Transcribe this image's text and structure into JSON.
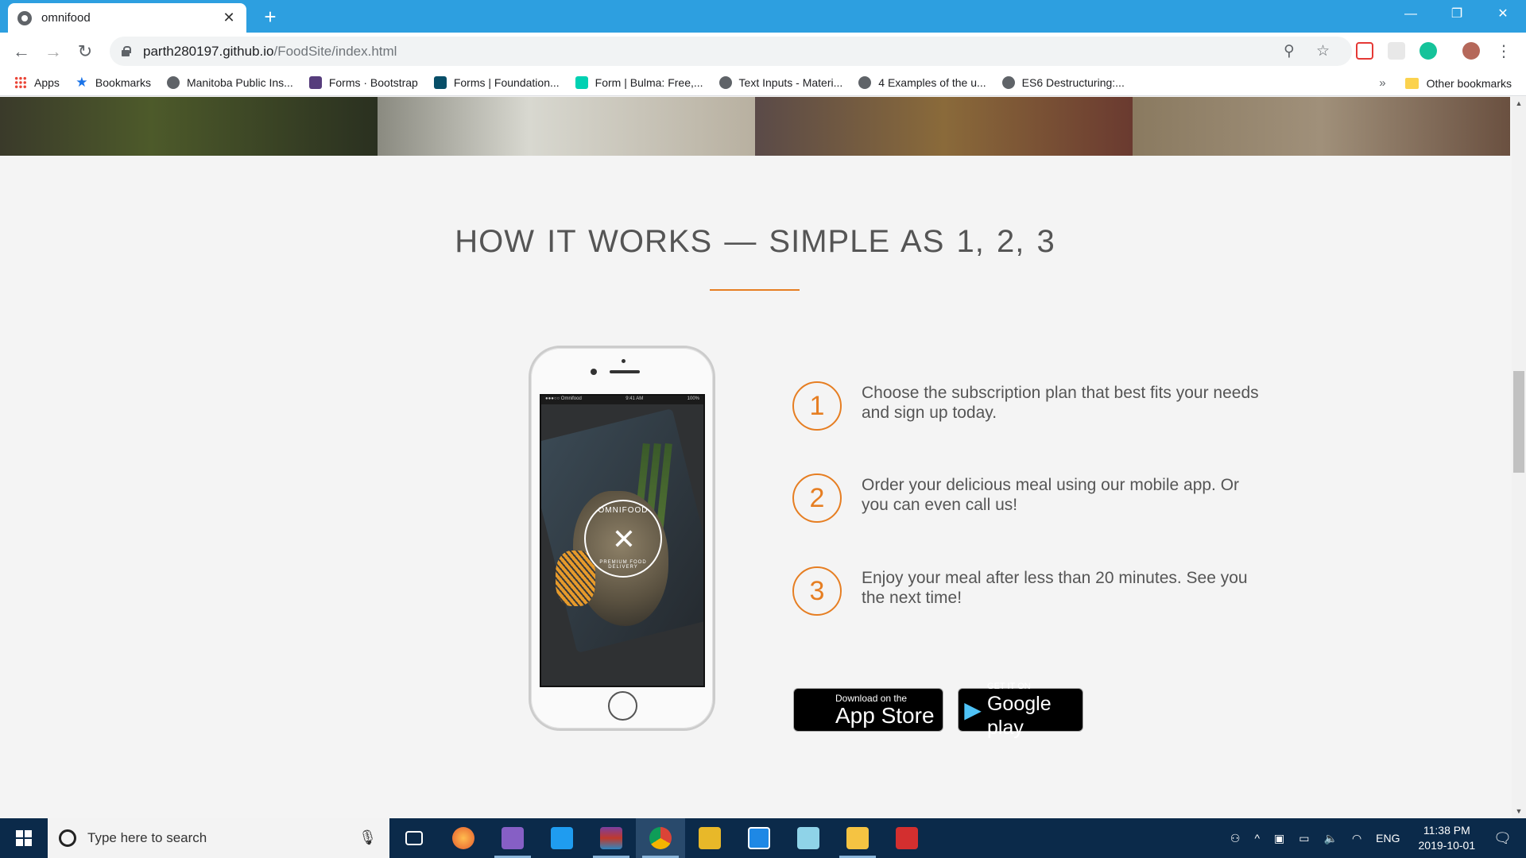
{
  "browser": {
    "tab_title": "omnifood",
    "new_tab_label": "+",
    "tab_close_label": "✕",
    "url_host": "parth280197.github.io",
    "url_path": "/FoodSite/index.html",
    "window_controls": {
      "minimize": "—",
      "maximize": "❐",
      "close": "✕"
    }
  },
  "bookmarks": {
    "items": [
      {
        "label": "Apps",
        "icon": "apps-grid-icon"
      },
      {
        "label": "Bookmarks",
        "icon": "star-icon"
      },
      {
        "label": "Manitoba Public Ins...",
        "icon": "globe-icon"
      },
      {
        "label": "Forms · Bootstrap",
        "icon": "bootstrap-icon"
      },
      {
        "label": "Forms | Foundation...",
        "icon": "foundation-icon"
      },
      {
        "label": "Form | Bulma: Free,...",
        "icon": "bulma-icon"
      },
      {
        "label": "Text Inputs - Materi...",
        "icon": "globe-icon"
      },
      {
        "label": "4 Examples of the u...",
        "icon": "globe-icon"
      },
      {
        "label": "ES6 Destructuring:...",
        "icon": "globe-icon"
      }
    ],
    "overflow_label": "»",
    "other_label": "Other bookmarks"
  },
  "page": {
    "section_title": "HOW IT WORKS — SIMPLE AS 1, 2, 3",
    "phone_status": {
      "carrier": "●●●○○ Omnifood",
      "time": "9:41 AM",
      "battery": "100%"
    },
    "app_logo_top": "OMNIFOOD",
    "app_logo_bottom": "PREMIUM FOOD DELIVERY",
    "steps": [
      {
        "number": "1",
        "text": "Choose the subscription plan that best fits your needs and sign up today."
      },
      {
        "number": "2",
        "text": "Order your delicious meal using our mobile app. Or you can even call us!"
      },
      {
        "number": "3",
        "text": "Enjoy your meal after less than 20 minutes. See you the next time!"
      }
    ],
    "app_store": {
      "small": "Download on the",
      "big": "App Store"
    },
    "google_play": {
      "small": "GET IT ON",
      "big": "Google play"
    }
  },
  "taskbar": {
    "search_placeholder": "Type here to search",
    "language": "ENG",
    "time": "11:38 PM",
    "date": "2019-10-01"
  },
  "colors": {
    "accent": "#e67e22",
    "titlebar": "#2d9fe0",
    "taskbar": "#0b2a4a"
  }
}
